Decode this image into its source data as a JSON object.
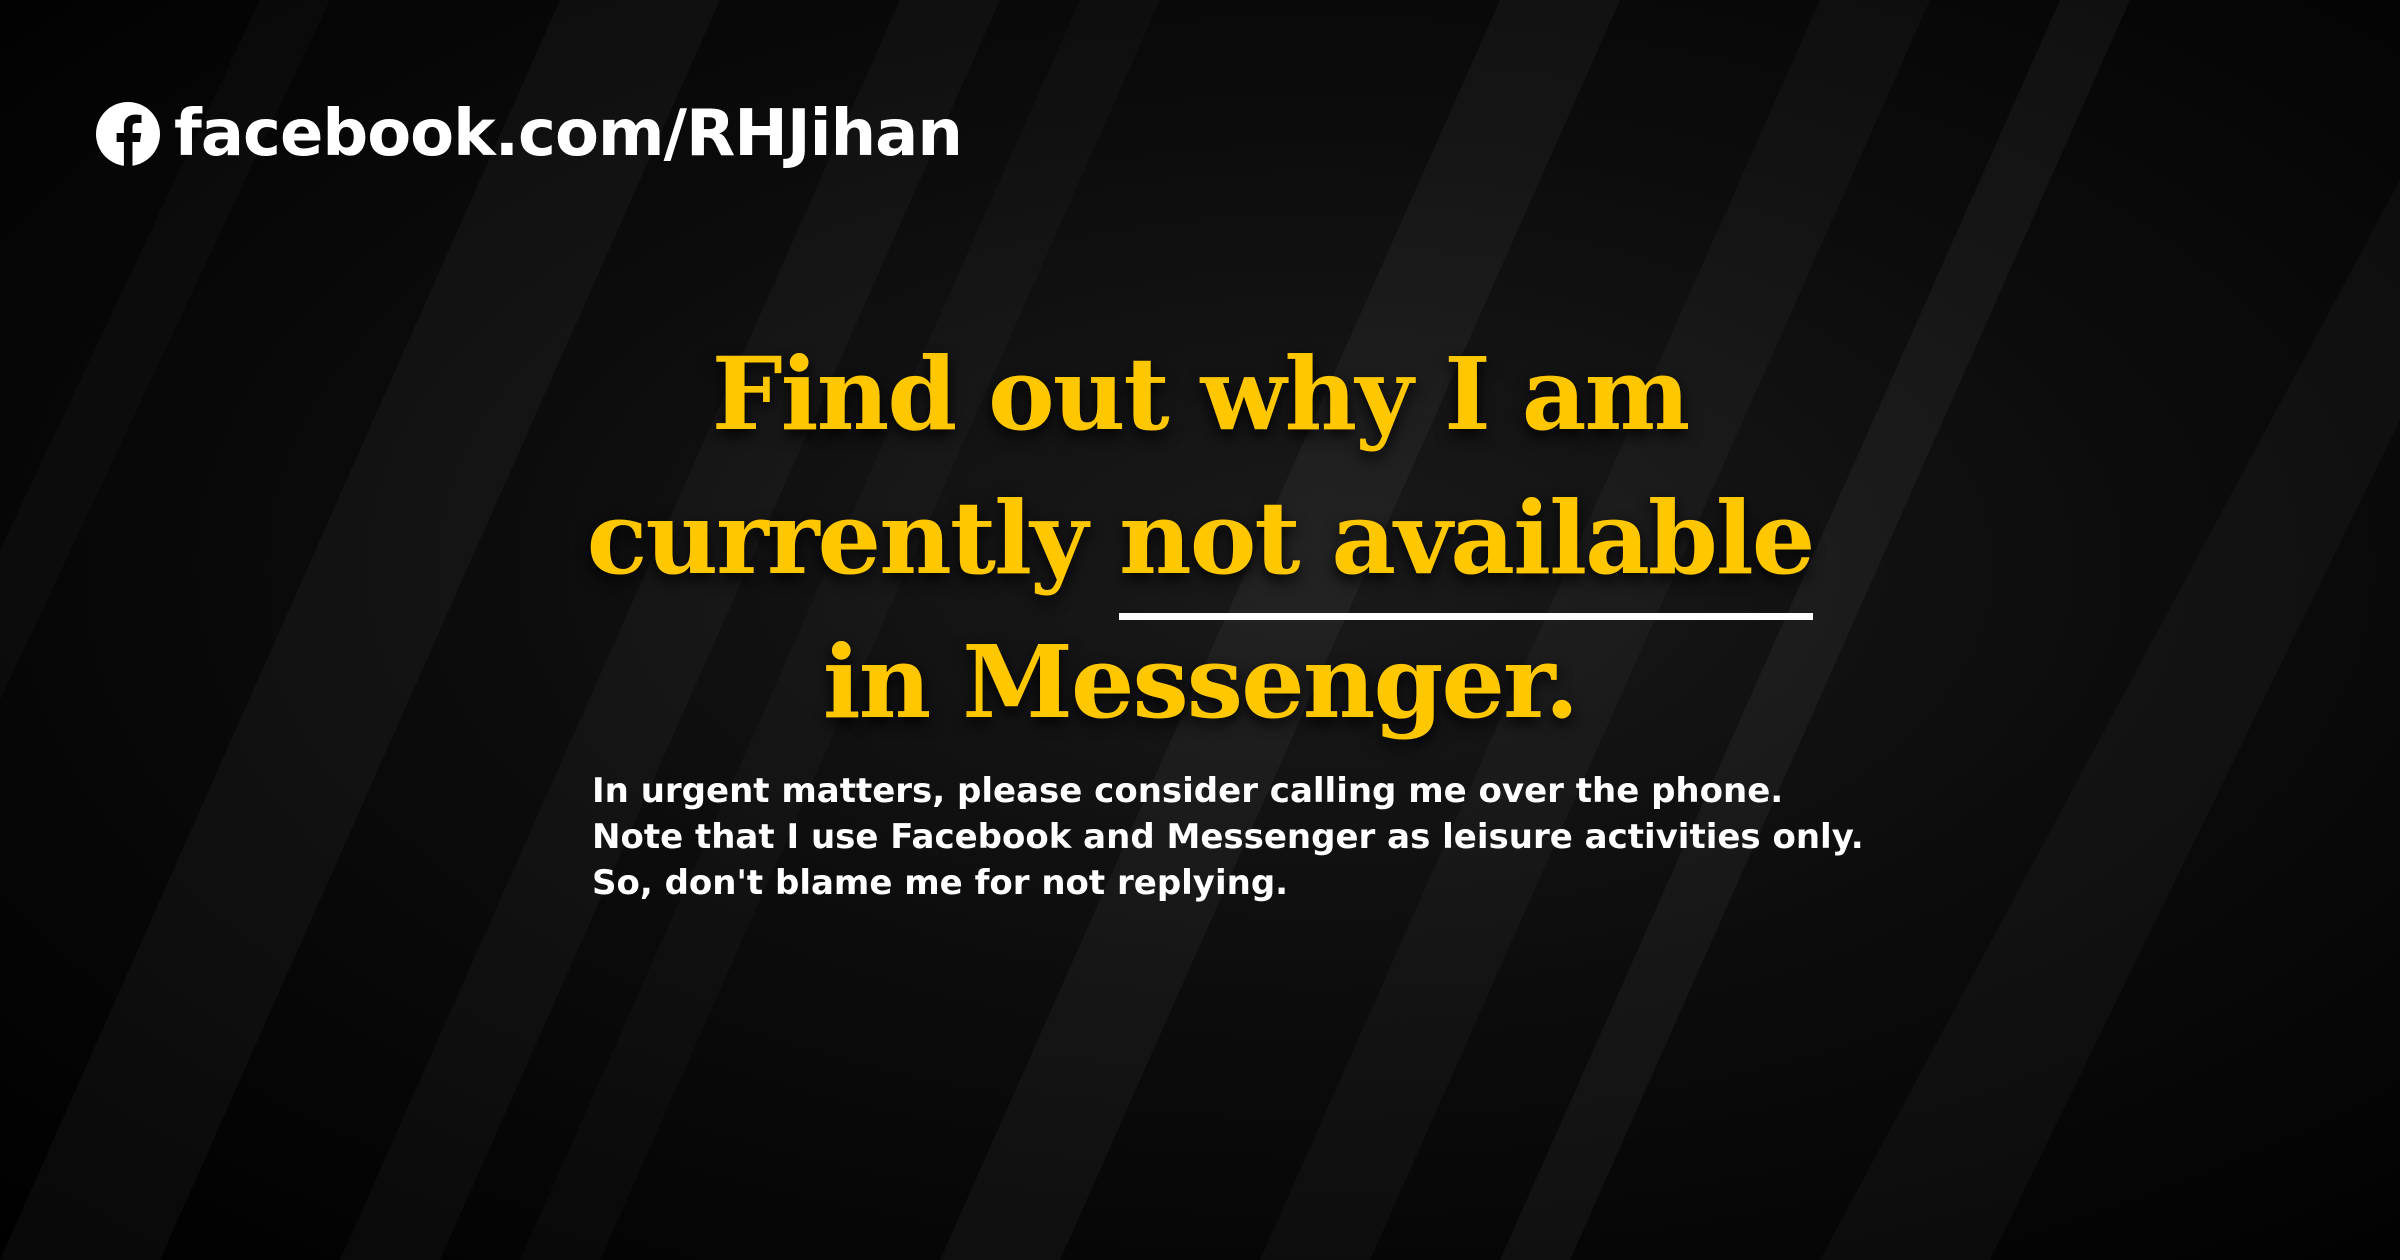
{
  "brand": {
    "icon": "facebook-icon",
    "text": "facebook.com/RHJihan"
  },
  "headline": {
    "line1": "Find out why I am",
    "line2_pre": "currently ",
    "line2_underlined": "not available",
    "line3": "in Messenger."
  },
  "body": {
    "line1": "In urgent matters, please consider calling me over the phone.",
    "line2": "Note that I use Facebook and Messenger as leisure activities only.",
    "line3": "So, don't blame me for not replying."
  },
  "colors": {
    "background": "#050505",
    "headline": "#ffc700",
    "text": "#ffffff",
    "underline": "#ffffff"
  }
}
